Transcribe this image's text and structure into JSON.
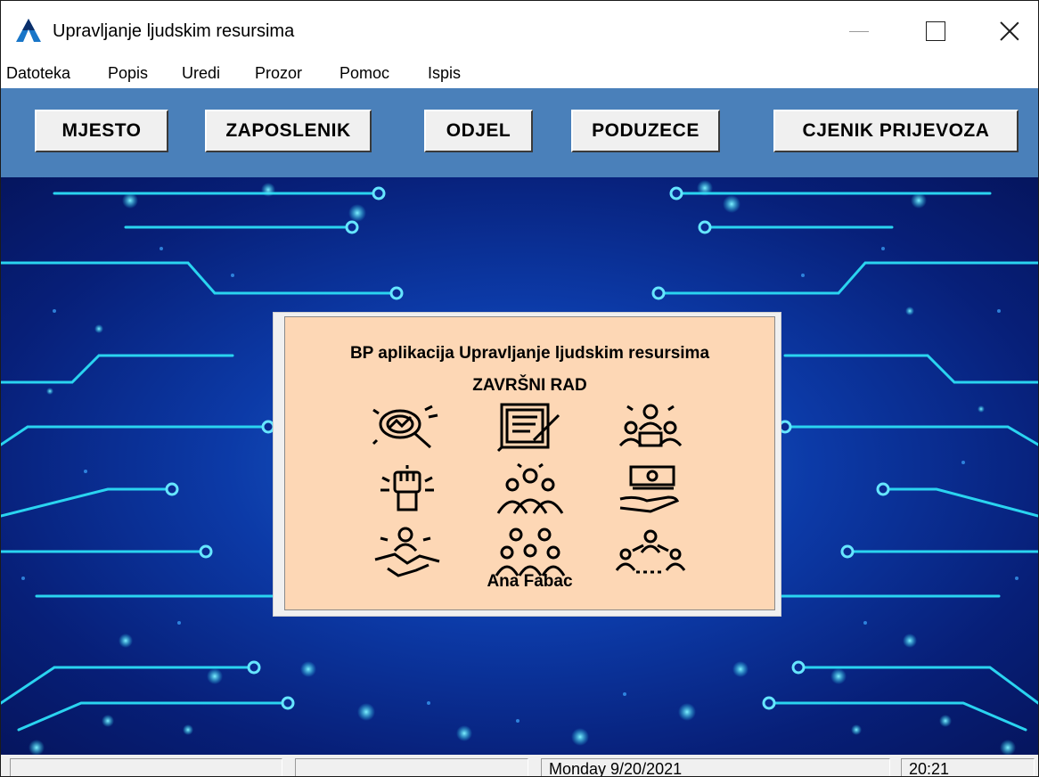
{
  "window": {
    "title": "Upravljanje ljudskim resursima",
    "icon": "app-triangle-icon"
  },
  "menu": [
    "Datoteka",
    "Popis",
    "Uredi",
    "Prozor",
    "Pomoc",
    "Ispis"
  ],
  "toolbar": {
    "buttons": [
      "MJESTO",
      "ZAPOSLENIK",
      "ODJEL",
      "PODUZECE",
      "CJENIK PRIJEVOZA"
    ]
  },
  "splash": {
    "title": "BP aplikacija Upravljanje ljudskim resursima",
    "subtitle": "ZAVRŠNI RAD",
    "author": "Ana Fabac",
    "icons": [
      "magnifier-analysis-icon",
      "document-edit-icon",
      "team-meeting-icon",
      "fist-power-icon",
      "team-group-icon",
      "money-hand-icon",
      "handshake-icon",
      "crowd-people-icon",
      "network-people-icon"
    ]
  },
  "statusbar": {
    "panel1": "",
    "panel2": "",
    "date": "Monday 9/20/2021",
    "time": "20:21"
  },
  "colors": {
    "toolbar_bg": "#4a80ba",
    "splash_bg": "#fdd7b5",
    "circuit_line": "#2ad4f0",
    "bg_dark": "#05155e"
  }
}
